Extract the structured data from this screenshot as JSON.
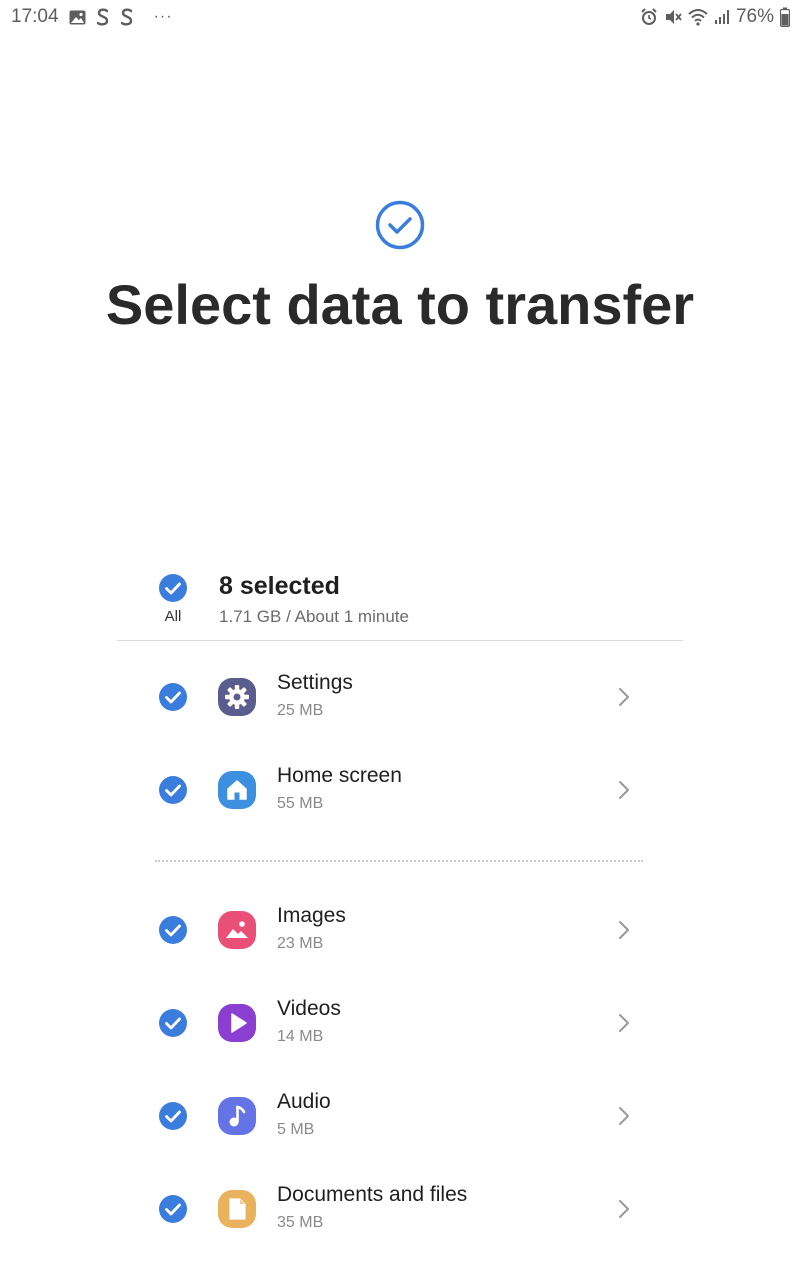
{
  "status_bar": {
    "time": "17:04",
    "battery": "76%",
    "more_dots": "···"
  },
  "header": {
    "title": "Select data to transfer"
  },
  "summary": {
    "all_label": "All",
    "selected_text": "8 selected",
    "detail_text": "1.71 GB / About 1 minute"
  },
  "items": [
    {
      "name": "Settings",
      "size": "25 MB",
      "checked": true,
      "icon": "gear-icon",
      "color": "#5b5d8f"
    },
    {
      "name": "Home screen",
      "size": "55 MB",
      "checked": true,
      "icon": "home-icon",
      "color": "#3d8fe0"
    },
    {
      "name": "Images",
      "size": "23 MB",
      "checked": true,
      "icon": "image-icon",
      "color": "#ea4f78"
    },
    {
      "name": "Videos",
      "size": "14 MB",
      "checked": true,
      "icon": "play-icon",
      "color": "#8b3fd1"
    },
    {
      "name": "Audio",
      "size": "5 MB",
      "checked": true,
      "icon": "music-icon",
      "color": "#6474e6"
    },
    {
      "name": "Documents and files",
      "size": "35 MB",
      "checked": true,
      "icon": "document-icon",
      "color": "#e9b25d"
    }
  ],
  "colors": {
    "accent": "#3b7ddd"
  }
}
